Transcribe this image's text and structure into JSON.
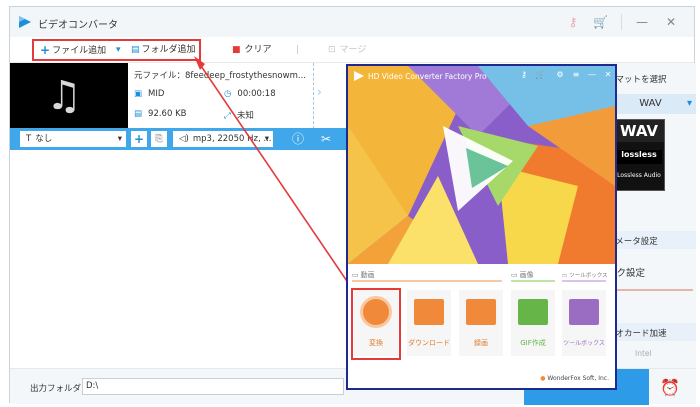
{
  "window": {
    "title": "ビデオコンバータ"
  },
  "toolbar": {
    "add_file": "ファイル追加",
    "add_folder": "フォルダ追加",
    "clear": "クリア",
    "merge": "マージ"
  },
  "file": {
    "name_label": "元ファイル：",
    "name": "8feedeep_frostythesnowm...",
    "format": "MID",
    "duration": "00:00:18",
    "size": "92.60 KB",
    "resolution": "未知"
  },
  "options": {
    "subtitle": "なし",
    "audio": "mp3, 22050 Hz, ..."
  },
  "right_panel": {
    "format_title": "ーマットを選択",
    "format_value": "WAV",
    "wav_badge": "WAV",
    "lossless": "lossless",
    "lossless_audio": "Lossless Audio",
    "param_settings": "ラメータ設定",
    "quality_settings": "ック設定",
    "gpu_accel": "デオカード加速",
    "gpu_vendor": "Intel"
  },
  "bottom": {
    "output_label": "出力フォルダ：",
    "output_path": "D:\\"
  },
  "factory": {
    "title": "HD Video Converter Factory Pro",
    "section_video": "動画",
    "section_image": "画像",
    "section_toolbox": "ツールボックス",
    "tile_convert": "変換",
    "tile_download": "ダウンロード",
    "tile_record": "録画",
    "tile_gif": "GIF作成",
    "tile_toolbox": "ツールボックス",
    "footer": "WonderFox Soft, Inc."
  },
  "colors": {
    "accent_blue": "#2d9be8",
    "highlight_red": "#e53a3a",
    "overlay_border": "#1e2a8f",
    "tile_orange": "#f08a3a",
    "tile_green": "#65b548",
    "tile_purple": "#9a6dc2"
  },
  "icons": {
    "add": "plus",
    "folder": "folder",
    "clear": "trash",
    "merge": "merge",
    "music": "music-note",
    "subtitle": "T",
    "audio": "speaker",
    "info": "info",
    "cut": "scissors"
  }
}
